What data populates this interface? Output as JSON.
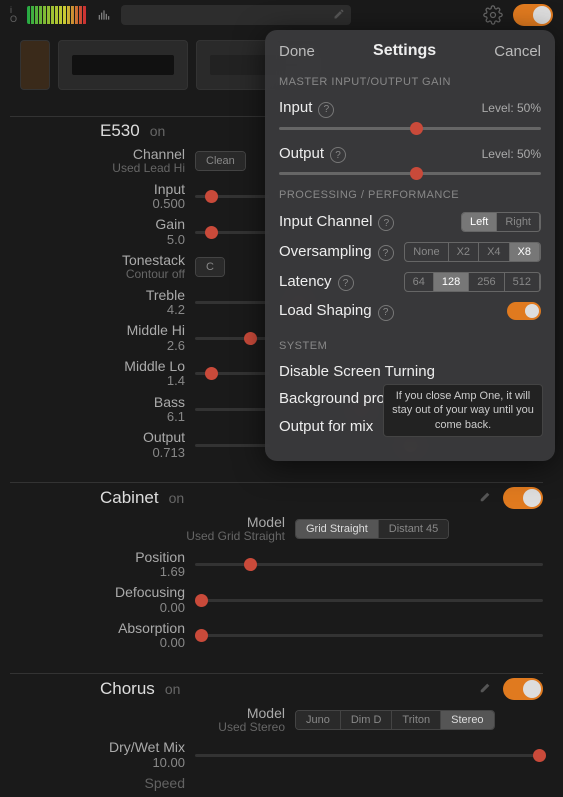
{
  "topbar": {
    "io_label_i": "i",
    "io_label_o": "O"
  },
  "sections": {
    "e530": {
      "title": "E530",
      "on_label": "on",
      "channel": {
        "label": "Channel",
        "sub": "Used Lead Hi",
        "clean": "Clean"
      },
      "params": {
        "input": {
          "label": "Input",
          "val": "0.500",
          "pos": 0.03
        },
        "gain": {
          "label": "Gain",
          "val": "5.0",
          "pos": 0.03
        },
        "tonestack": {
          "label": "Tonestack",
          "sub": "Contour off",
          "btn": "C"
        },
        "treble": {
          "label": "Treble",
          "val": "4.2",
          "pos": 0.28
        },
        "mid_hi": {
          "label": "Middle Hi",
          "val": "2.6",
          "pos": 0.14
        },
        "mid_lo": {
          "label": "Middle Lo",
          "val": "1.4",
          "pos": 0.03
        },
        "bass": {
          "label": "Bass",
          "val": "6.1",
          "pos": 0.46
        },
        "output": {
          "label": "Output",
          "val": "0.713",
          "pos": 0.6
        }
      }
    },
    "cabinet": {
      "title": "Cabinet",
      "on_label": "on",
      "model": {
        "label": "Model",
        "sub": "Used Grid Straight",
        "opts": [
          "Grid Straight",
          "Distant 45"
        ],
        "sel": 0
      },
      "params": {
        "position": {
          "label": "Position",
          "val": "1.69",
          "pos": 0.14
        },
        "defocusing": {
          "label": "Defocusing",
          "val": "0.00",
          "pos": 0.0
        },
        "absorption": {
          "label": "Absorption",
          "val": "0.00",
          "pos": 0.0
        }
      }
    },
    "chorus": {
      "title": "Chorus",
      "on_label": "on",
      "model": {
        "label": "Model",
        "sub": "Used Stereo",
        "opts": [
          "Juno",
          "Dim D",
          "Triton",
          "Stereo"
        ],
        "sel": 3
      },
      "params": {
        "drywet": {
          "label": "Dry/Wet Mix",
          "val": "10.00",
          "pos": 0.97
        },
        "speed": {
          "label": "Speed",
          "val": "",
          "pos": 0.5
        }
      }
    }
  },
  "settings": {
    "done": "Done",
    "title": "Settings",
    "cancel": "Cancel",
    "sec_master": "MASTER INPUT/OUTPUT GAIN",
    "input_label": "Input",
    "output_label": "Output",
    "level_input": "Level: 50%",
    "level_output": "Level: 50%",
    "sec_proc": "PROCESSING / PERFORMANCE",
    "input_channel": "Input Channel",
    "input_channel_opts": [
      "Left",
      "Right"
    ],
    "oversampling": "Oversampling",
    "oversampling_opts": [
      "None",
      "X2",
      "X4",
      "X8"
    ],
    "latency": "Latency",
    "latency_opts": [
      "64",
      "128",
      "256",
      "512"
    ],
    "latency_sel": 1,
    "load_shaping": "Load Shaping",
    "sec_system": "SYSTEM",
    "disable_screen": "Disable Screen Turning",
    "background": "Background processing",
    "output_mix": "Output for mix",
    "tooltip": "If you close Amp One, it will stay out of your way until you come back."
  }
}
